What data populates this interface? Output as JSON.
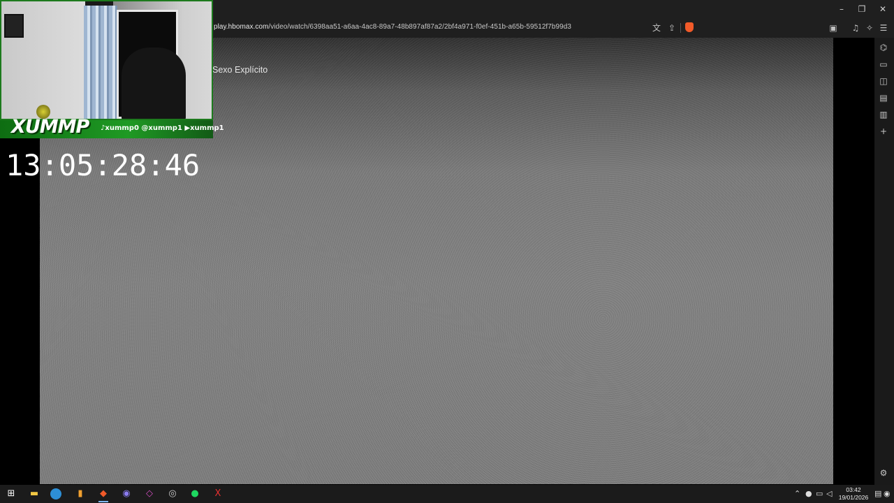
{
  "window": {
    "minimize": "–",
    "restore": "❐",
    "close": "✕"
  },
  "toolbar": {
    "url_host": "play.hbomax.com",
    "url_path": "/video/watch/6398aa51-a6aa-4ac8-89a7-48b897af87a2/2bf4a971-f0ef-451b-a65b-59512f7b99d3",
    "icons": [
      "translate-icon",
      "share-icon",
      "brave-shields-icon",
      "screenshot-icon",
      "music-icon",
      "leo-ai-icon",
      "menu-icon"
    ]
  },
  "video": {
    "title": "Sexo Explícito"
  },
  "overlay": {
    "brand": "XUMMP",
    "socials": "♪xummp0 @xummp1 ▶xummp1",
    "timer": "13:05:28:46"
  },
  "sidebar": {
    "icons": [
      "leo-icon",
      "video-icon",
      "wallet-icon",
      "bookmarks-icon",
      "reading-list-icon",
      "add-icon"
    ],
    "settings_icon": "gear-icon"
  },
  "taskbar": {
    "apps": [
      "windows-start-icon",
      "file-explorer-icon",
      "edge-icon",
      "charts-app-icon",
      "brave-icon",
      "discord-icon",
      "obsidian-icon",
      "stream-app-icon",
      "spotify-icon",
      "xummp-icon"
    ],
    "time": "03:42",
    "date": "19/01/2026"
  },
  "colors": {
    "accent_green": "#1d7a1d",
    "chrome_bg": "#1f1f1f",
    "taskbar_bg": "#1b1b1b"
  }
}
